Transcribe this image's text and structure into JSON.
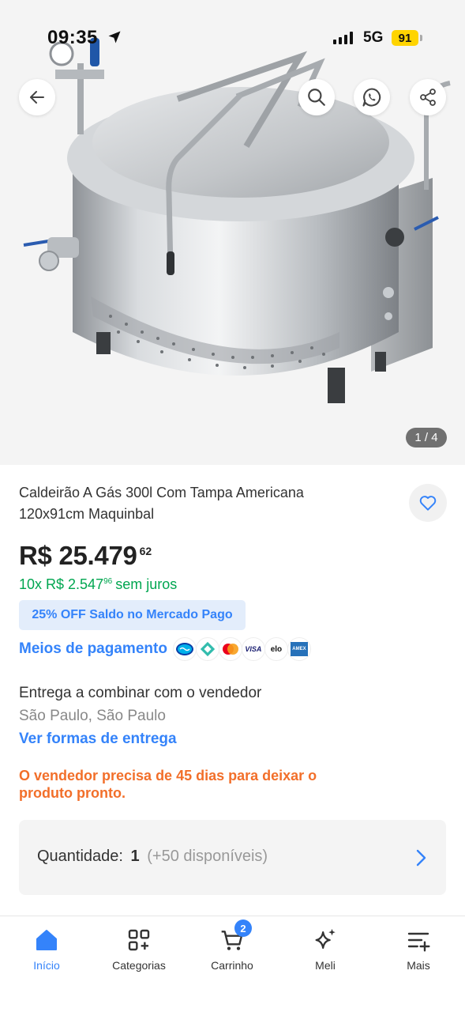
{
  "status_bar": {
    "time": "09:35",
    "network": "5G",
    "battery": "91"
  },
  "gallery": {
    "counter": "1 / 4"
  },
  "product": {
    "title": "Caldeirão A Gás 300l Com Tampa Americana 120x91cm Maquinbal",
    "price_main": "R$ 25.479",
    "price_cents": "62",
    "installments_prefix": "10x R$ 2.547",
    "installments_cents": "96",
    "installments_suffix": "sem juros",
    "discount_badge": "25% OFF Saldo no Mercado Pago"
  },
  "payment": {
    "link": "Meios de pagamento",
    "methods": [
      "mercado-pago-icon",
      "pix-icon",
      "mastercard-icon",
      "visa-icon",
      "elo-icon",
      "amex-icon"
    ],
    "visa_text": "VISA",
    "elo_text": "elo",
    "amex_text": "AMEX"
  },
  "delivery": {
    "title": "Entrega a combinar com o vendedor",
    "location": "São Paulo, São Paulo",
    "link": "Ver formas de entrega"
  },
  "notice": "O vendedor precisa de 45 dias para deixar o produto pronto.",
  "quantity": {
    "label": "Quantidade:",
    "value": "1",
    "available": "(+50 disponíveis)"
  },
  "nav": {
    "items": [
      {
        "label": "Início",
        "icon": "home-icon",
        "active": true
      },
      {
        "label": "Categorias",
        "icon": "categories-icon"
      },
      {
        "label": "Carrinho",
        "icon": "cart-icon",
        "badge": "2"
      },
      {
        "label": "Meli",
        "icon": "sparkle-icon"
      },
      {
        "label": "Mais",
        "icon": "menu-plus-icon"
      }
    ]
  },
  "colors": {
    "accent": "#3483fa",
    "green": "#00a650",
    "orange": "#f26f2a",
    "badge_bg": "#e3edfb",
    "battery": "#ffd400"
  }
}
